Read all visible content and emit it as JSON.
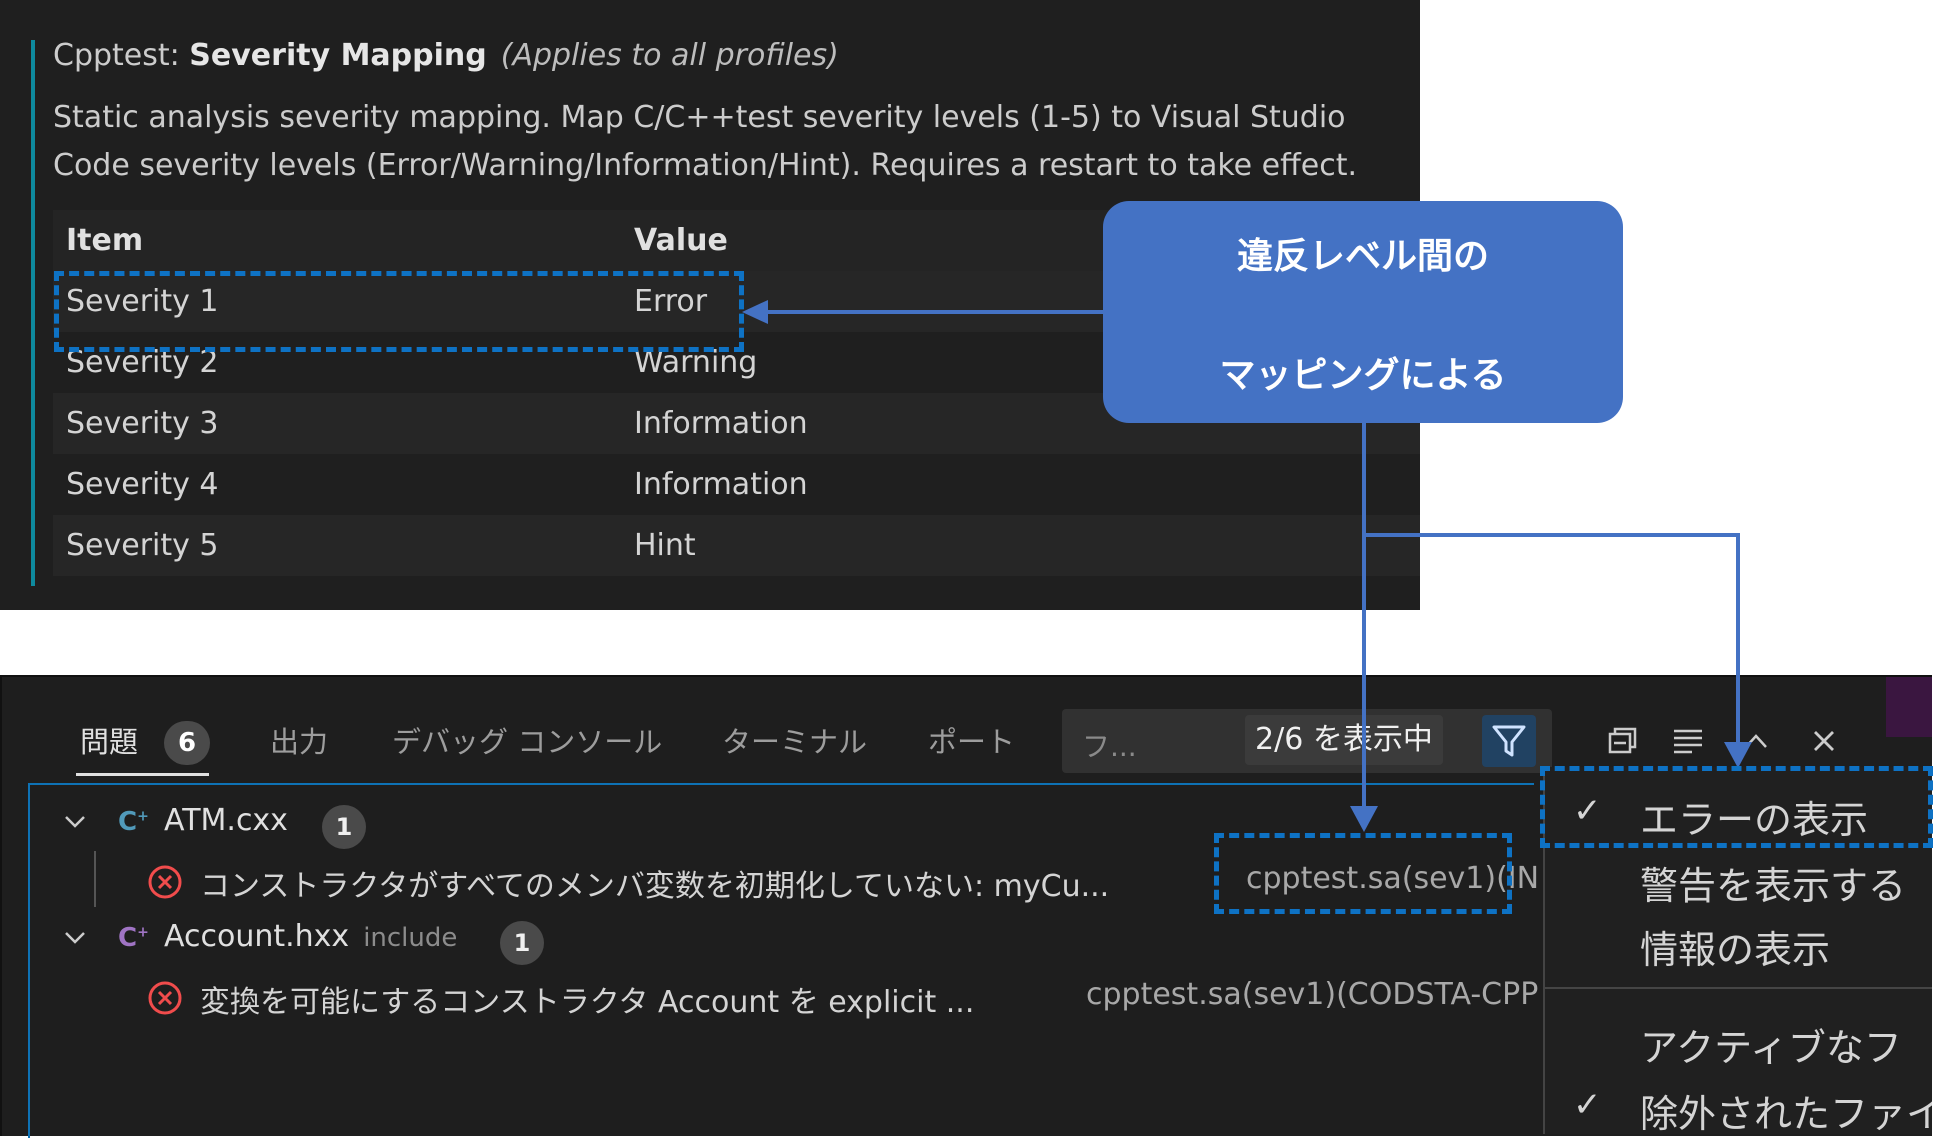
{
  "settings": {
    "title_prefix": "Cpptest: ",
    "title_name": "Severity Mapping",
    "title_scope": "(Applies to all profiles)",
    "description": "Static analysis severity mapping. Map C/C++test severity levels (1-5) to Visual Studio Code severity levels (Error/Warning/Information/Hint). Requires a restart to take effect.",
    "table": {
      "headers": {
        "item": "Item",
        "value": "Value"
      },
      "rows": [
        {
          "item": "Severity 1",
          "value": "Error"
        },
        {
          "item": "Severity 2",
          "value": "Warning"
        },
        {
          "item": "Severity 3",
          "value": "Information"
        },
        {
          "item": "Severity 4",
          "value": "Information"
        },
        {
          "item": "Severity 5",
          "value": "Hint"
        }
      ]
    }
  },
  "callout": {
    "line1": "違反レベル間の",
    "line2": "マッピングによる"
  },
  "panel": {
    "tabs": {
      "problems": "問題",
      "problems_count": "6",
      "output": "出力",
      "debug_console": "デバッグ コンソール",
      "terminal": "ターミナル",
      "ports": "ポート"
    },
    "filter": {
      "placeholder": "フ...",
      "count": "2/6 を表示中"
    },
    "icons": [
      "filter-icon",
      "collapse-all-icon",
      "word-wrap-icon",
      "chevron-up-icon",
      "close-icon"
    ],
    "files": [
      {
        "name": "ATM.cxx",
        "hint": "",
        "count": "1",
        "problem": {
          "message": "コンストラクタがすべてのメンバ変数を初期化していない: myCu...",
          "source": "cpptest.sa(sev1)(IN"
        }
      },
      {
        "name": "Account.hxx",
        "hint": "include",
        "count": "1",
        "problem": {
          "message": "変換を可能にするコンストラクタ Account を explicit ...",
          "source": "cpptest.sa(sev1)(CODSTA-CPP"
        }
      }
    ]
  },
  "filter_menu": {
    "items": [
      {
        "label": "エラーの表示",
        "checked": "✓"
      },
      {
        "label": "警告を表示する",
        "checked": ""
      },
      {
        "label": "情報の表示",
        "checked": ""
      },
      {
        "label": "アクティブなフ",
        "checked": ""
      },
      {
        "label": "除外されたファイ",
        "checked": "✓"
      }
    ]
  },
  "colors": {
    "callout": "#4472c4",
    "annotation_dash": "#0e72c4",
    "error_icon": "#f14c4c",
    "cpp_icon_blue": "#519aba",
    "cpp_icon_purple": "#a074c4"
  }
}
